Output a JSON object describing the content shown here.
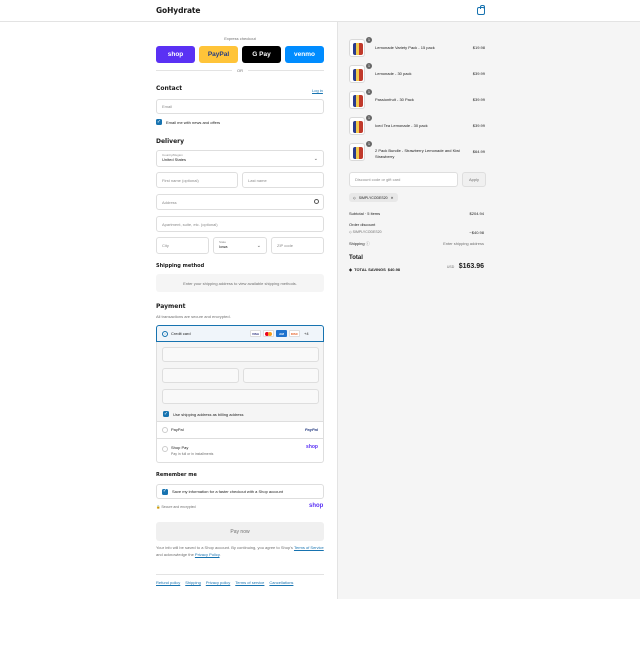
{
  "header": {
    "brand": "GoHydrate"
  },
  "express": {
    "label": "Express checkout",
    "buttons": [
      {
        "label": "shop",
        "bg": "#5a31f4",
        "fg": "#ffffff"
      },
      {
        "label": "PayPal",
        "bg": "#ffc439",
        "fg": "#253b80"
      },
      {
        "label": "G Pay",
        "bg": "#000000",
        "fg": "#ffffff"
      },
      {
        "label": "venmo",
        "bg": "#008cff",
        "fg": "#ffffff"
      }
    ],
    "or": "OR"
  },
  "contact": {
    "title": "Contact",
    "login": "Log in",
    "email_placeholder": "Email",
    "news_label": "Email me with news and offers"
  },
  "delivery": {
    "title": "Delivery",
    "country_label": "Country/Region",
    "country_value": "United States",
    "first_name": "First name (optional)",
    "last_name": "Last name",
    "address": "Address",
    "apartment": "Apartment, suite, etc. (optional)",
    "city": "City",
    "state_label": "State",
    "state_value": "Iowa",
    "zip": "ZIP code"
  },
  "shipping": {
    "title": "Shipping method",
    "message": "Enter your shipping address to view available shipping methods."
  },
  "payment": {
    "title": "Payment",
    "subtitle": "All transactions are secure and encrypted.",
    "credit_card": "Credit card",
    "more_cards": "+4",
    "billing_label": "Use shipping address as billing address",
    "paypal": "PayPal",
    "shoppay": "Shop Pay",
    "shoppay_sub": "Pay in full or in installments",
    "paypal_logo": "PayPal",
    "shop_logo": "shop"
  },
  "remember": {
    "title": "Remember me",
    "label": "Save my information for a faster checkout with a Shop account",
    "secure": "Secure and encrypted",
    "shop_logo": "shop"
  },
  "pay_now": "Pay now",
  "legal": {
    "t1": "Your info will be saved to a Shop account. By continuing, you agree to Shop's ",
    "terms": "Terms of Service",
    "t2": " and acknowledge the ",
    "privacy": "Privacy Policy",
    "t3": "."
  },
  "footer": [
    "Refund policy",
    "Shipping",
    "Privacy policy",
    "Terms of service",
    "Cancellations"
  ],
  "cart": {
    "items": [
      {
        "name": "Lemonade Variety Pack - 15 pack",
        "price": "$19.98",
        "qty": "1"
      },
      {
        "name": "Lemonade - 30 pack",
        "price": "$39.99",
        "qty": "1"
      },
      {
        "name": "Passionfruit - 30 Pack",
        "price": "$39.99",
        "qty": "1"
      },
      {
        "name": "Iced Tea Lemonade - 30 pack",
        "price": "$39.99",
        "qty": "1"
      },
      {
        "name": "2 Pack Bundle - Strawberry Lemonade and Kiwi Strawberry",
        "price": "$64.99",
        "qty": "1"
      }
    ],
    "discount_placeholder": "Discount code or gift card",
    "apply": "Apply",
    "code_tag": "SIMPLYCODES20",
    "subtotal_label": "Subtotal · 5 items",
    "subtotal": "$204.94",
    "order_discount_label": "Order discount",
    "order_code": "SIMPLYCODES20",
    "order_discount": "−$40.98",
    "shipping_label": "Shipping",
    "shipping_value": "Enter shipping address",
    "total_label": "Total",
    "currency": "USD",
    "total": "$163.96",
    "savings_label": "TOTAL SAVINGS",
    "savings": "$40.98"
  }
}
